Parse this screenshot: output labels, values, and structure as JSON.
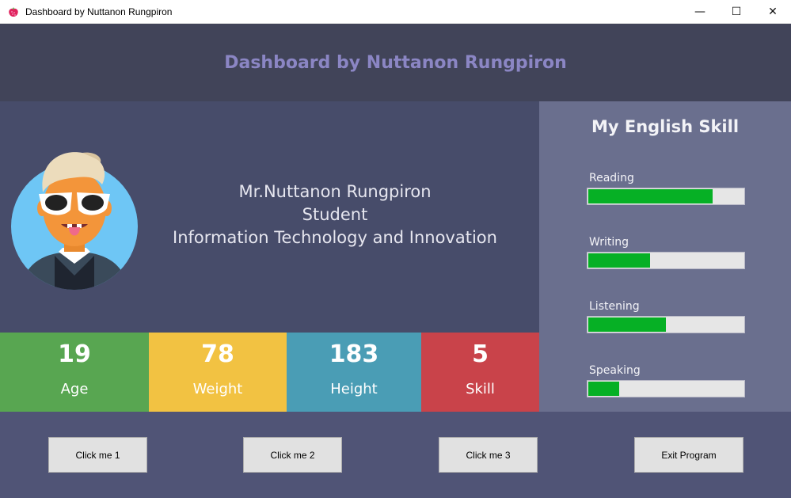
{
  "window": {
    "title": "Dashboard by Nuttanon Rungpiron",
    "controls": {
      "minimize": "—",
      "maximize": "☐",
      "close": "✕"
    },
    "icon": "strawberry-icon"
  },
  "header": {
    "title": "Dashboard by Nuttanon Rungpiron"
  },
  "profile": {
    "name": "Mr.Nuttanon Rungpiron",
    "role": "Student",
    "program": "Information Technology and Innovation",
    "avatar_icon": "cartoon-avatar-sunglasses"
  },
  "stats": [
    {
      "value": "19",
      "label": "Age",
      "color": "#58a651"
    },
    {
      "value": "78",
      "label": "Weight",
      "color": "#f2c242"
    },
    {
      "value": "183",
      "label": "Height",
      "color": "#4a9db5"
    },
    {
      "value": "5",
      "label": "Skill",
      "color": "#c9434a"
    }
  ],
  "skills": {
    "title": "My English Skill",
    "items": [
      {
        "label": "Reading",
        "progress": 0.8
      },
      {
        "label": "Writing",
        "progress": 0.4
      },
      {
        "label": "Listening",
        "progress": 0.5
      },
      {
        "label": "Speaking",
        "progress": 0.2
      }
    ],
    "bar_color": "#06b025"
  },
  "buttons": {
    "click1": "Click me 1",
    "click2": "Click me 2",
    "click3": "Click me 3",
    "exit": "Exit Program"
  },
  "colors": {
    "header_bg": "#414459",
    "header_text": "#8b86c4",
    "profile_bg": "#474c6a",
    "skills_bg": "#6a6f8e",
    "footer_bg": "#505476"
  }
}
